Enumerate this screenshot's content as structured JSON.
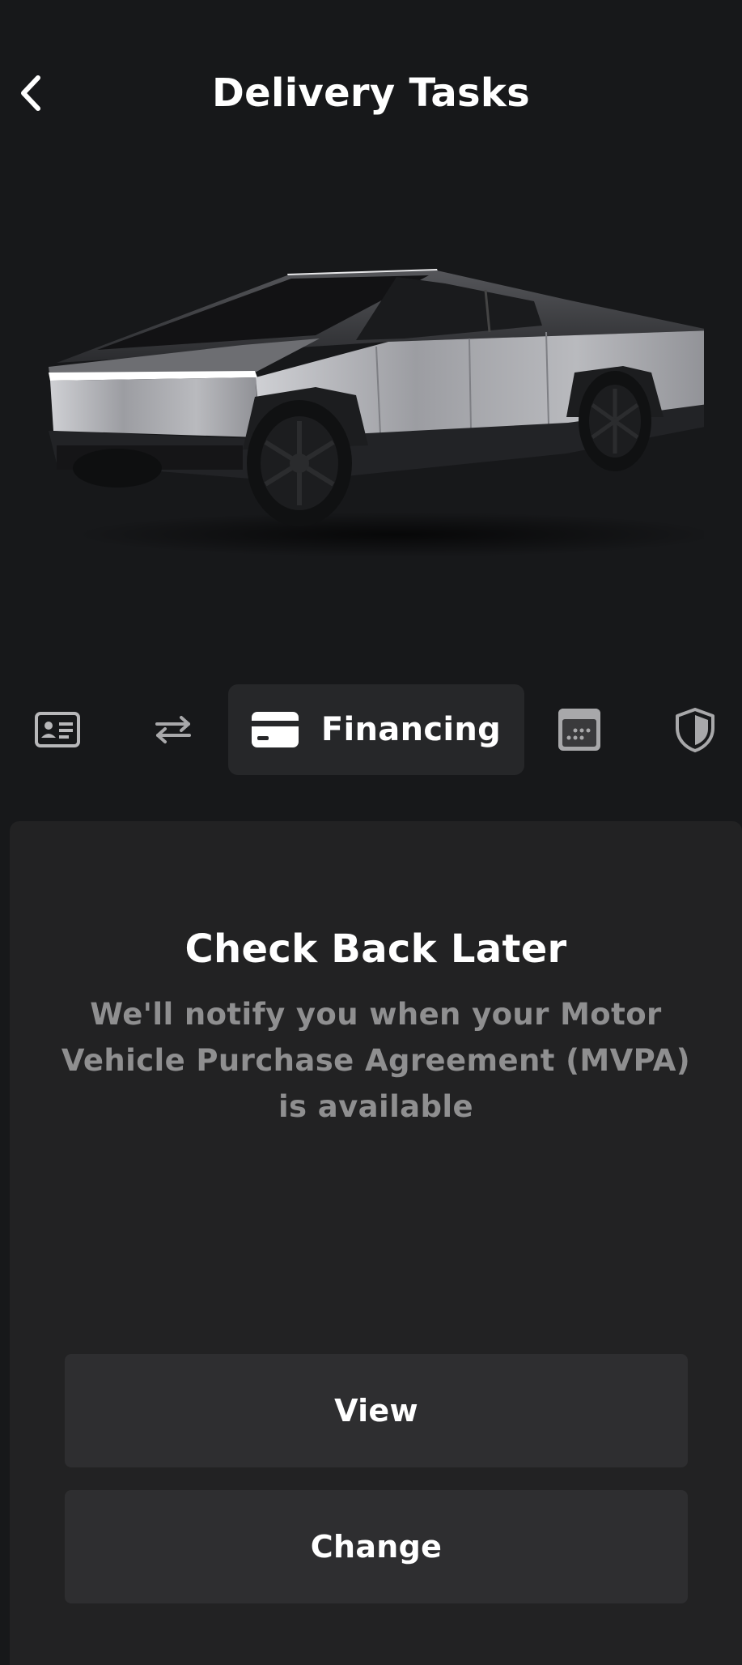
{
  "header": {
    "title": "Delivery Tasks"
  },
  "tabs": {
    "items": [
      {
        "icon": "id-card-icon",
        "label": ""
      },
      {
        "icon": "transfer-arrows-icon",
        "label": ""
      },
      {
        "icon": "credit-card-icon",
        "label": "Financing",
        "active": true
      },
      {
        "icon": "calendar-icon",
        "label": ""
      },
      {
        "icon": "shield-icon",
        "label": ""
      }
    ]
  },
  "card": {
    "title": "Check Back Later",
    "message": "We'll notify you when your Motor Vehicle Purchase Agreement (MVPA) is available",
    "view_label": "View",
    "change_label": "Change"
  },
  "colors": {
    "background": "#17181a",
    "card": "#222223",
    "button": "#2e2e30",
    "active_tab": "#262729",
    "muted_text": "#8f8f90"
  }
}
